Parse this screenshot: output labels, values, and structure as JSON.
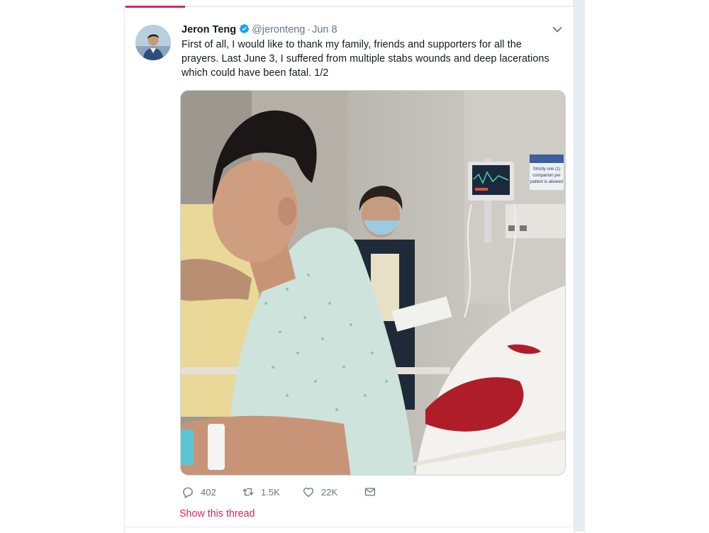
{
  "tweet": {
    "display_name": "Jeron Teng",
    "handle": "@jeronteng",
    "separator": "·",
    "date": "Jun 8",
    "text": "First of all, I would like to thank my family, friends and supporters for all the prayers. Last June 3, I suffered from multiple stabs wounds and deep lacerations which could have been fatal. 1/2",
    "media": {
      "sign_line1": "Strictly one (1)",
      "sign_line2": "companion per",
      "sign_line3": "patient is allowed"
    },
    "actions": {
      "reply_count": "402",
      "retweet_count": "1.5K",
      "like_count": "22K"
    },
    "thread_link": "Show this thread"
  },
  "colors": {
    "accent": "#e0245e",
    "verified": "#1da1f2",
    "secondary_text": "#657786",
    "divider": "#e6ecf0"
  },
  "icons": [
    "verified-badge-icon",
    "chevron-down-icon",
    "reply-icon",
    "retweet-icon",
    "like-icon",
    "direct-message-icon"
  ]
}
